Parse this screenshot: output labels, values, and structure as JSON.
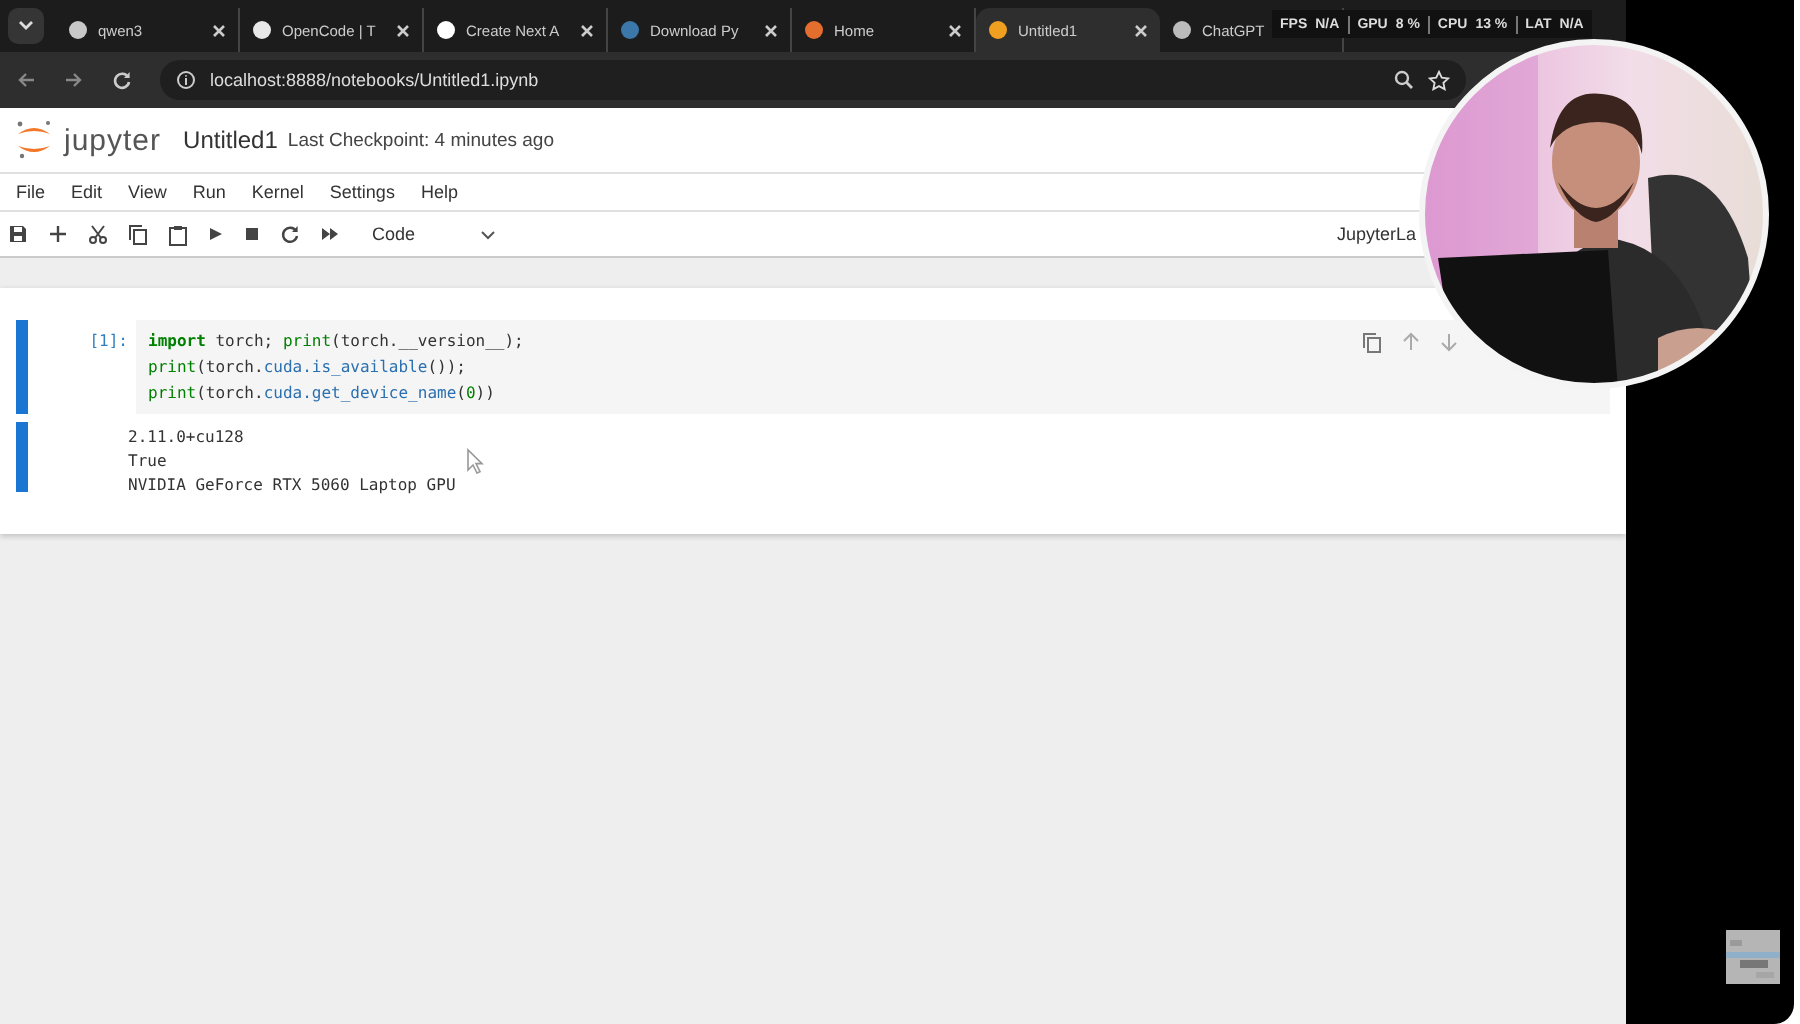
{
  "browser": {
    "tabs": [
      {
        "title": "qwen3",
        "selected": false
      },
      {
        "title": "OpenCode | T",
        "selected": false
      },
      {
        "title": "Create Next A",
        "selected": false
      },
      {
        "title": "Download Py",
        "selected": false
      },
      {
        "title": "Home",
        "selected": false
      },
      {
        "title": "Untitled1",
        "selected": true
      },
      {
        "title": "ChatGPT",
        "selected": false
      }
    ],
    "url": "localhost:8888/notebooks/Untitled1.ipynb"
  },
  "overlay_stats": [
    {
      "label": "FPS",
      "value": "N/A"
    },
    {
      "label": "GPU",
      "value": "8 %"
    },
    {
      "label": "CPU",
      "value": "13 %"
    },
    {
      "label": "LAT",
      "value": "N/A"
    }
  ],
  "notebook": {
    "logo": "jupyter",
    "title": "Untitled1",
    "checkpoint": "Last Checkpoint: 4 minutes ago",
    "menu": [
      "File",
      "Edit",
      "View",
      "Run",
      "Kernel",
      "Settings",
      "Help"
    ],
    "cell_type": "Code",
    "right_label": "JupyterLa",
    "cells": [
      {
        "prompt": "[1]:",
        "code": [
          [
            {
              "text": "import",
              "kind": "keyword"
            },
            {
              "text": " torch; ",
              "kind": "plain"
            },
            {
              "text": "print",
              "kind": "builtin"
            },
            {
              "text": "(torch.__version__);",
              "kind": "plain"
            }
          ],
          [
            {
              "text": "print",
              "kind": "builtin"
            },
            {
              "text": "(torch.",
              "kind": "plain"
            },
            {
              "text": "cuda.is_available",
              "kind": "attr"
            },
            {
              "text": "());",
              "kind": "plain"
            }
          ],
          [
            {
              "text": "print",
              "kind": "builtin"
            },
            {
              "text": "(torch.",
              "kind": "plain"
            },
            {
              "text": "cuda.get_device_name",
              "kind": "attr"
            },
            {
              "text": "(",
              "kind": "plain"
            },
            {
              "text": "0",
              "kind": "number"
            },
            {
              "text": "))",
              "kind": "plain"
            }
          ]
        ],
        "output": [
          "2.11.0+cu128",
          "True",
          "NVIDIA GeForce RTX 5060 Laptop GPU"
        ]
      }
    ]
  }
}
